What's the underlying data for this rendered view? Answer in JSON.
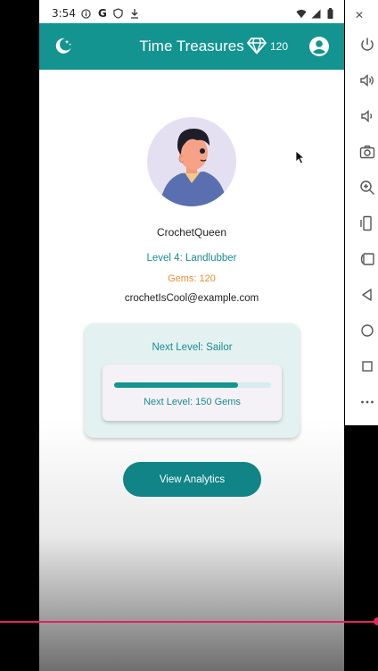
{
  "status_bar": {
    "time": "3:54",
    "icons": [
      "info-icon",
      "google-g-icon",
      "shield-icon",
      "download-icon",
      "wifi-icon",
      "signal-icon",
      "battery-icon"
    ]
  },
  "app_bar": {
    "title": "Time Treasures",
    "gem_count": "120",
    "icons": {
      "theme": "moon-icon",
      "gem": "diamond-icon",
      "account": "account-circle-icon"
    },
    "color": "#139491"
  },
  "profile": {
    "username": "CrochetQueen",
    "level": "Level 4: Landlubber",
    "gems": "Gems: 120",
    "email": "crochetIsCool@example.com"
  },
  "progress_card": {
    "next_level": "Next Level: Sailor",
    "progress_fraction": 0.79,
    "gems_needed": "Next Level: 150 Gems"
  },
  "actions": {
    "view_analytics": "View Analytics"
  },
  "emulator_toolbar": {
    "items": [
      "close-icon",
      "power-icon",
      "volume-up-icon",
      "volume-down-icon",
      "camera-icon",
      "zoom-icon",
      "rotate-left-icon",
      "rotate-right-icon",
      "back-icon",
      "home-icon",
      "overview-icon",
      "more-icon"
    ]
  },
  "colors": {
    "accent": "#139491",
    "level_text": "#1a8b91",
    "gems_text": "#ef8d2e",
    "card_bg": "#e3f1f1",
    "button": "#108486"
  }
}
